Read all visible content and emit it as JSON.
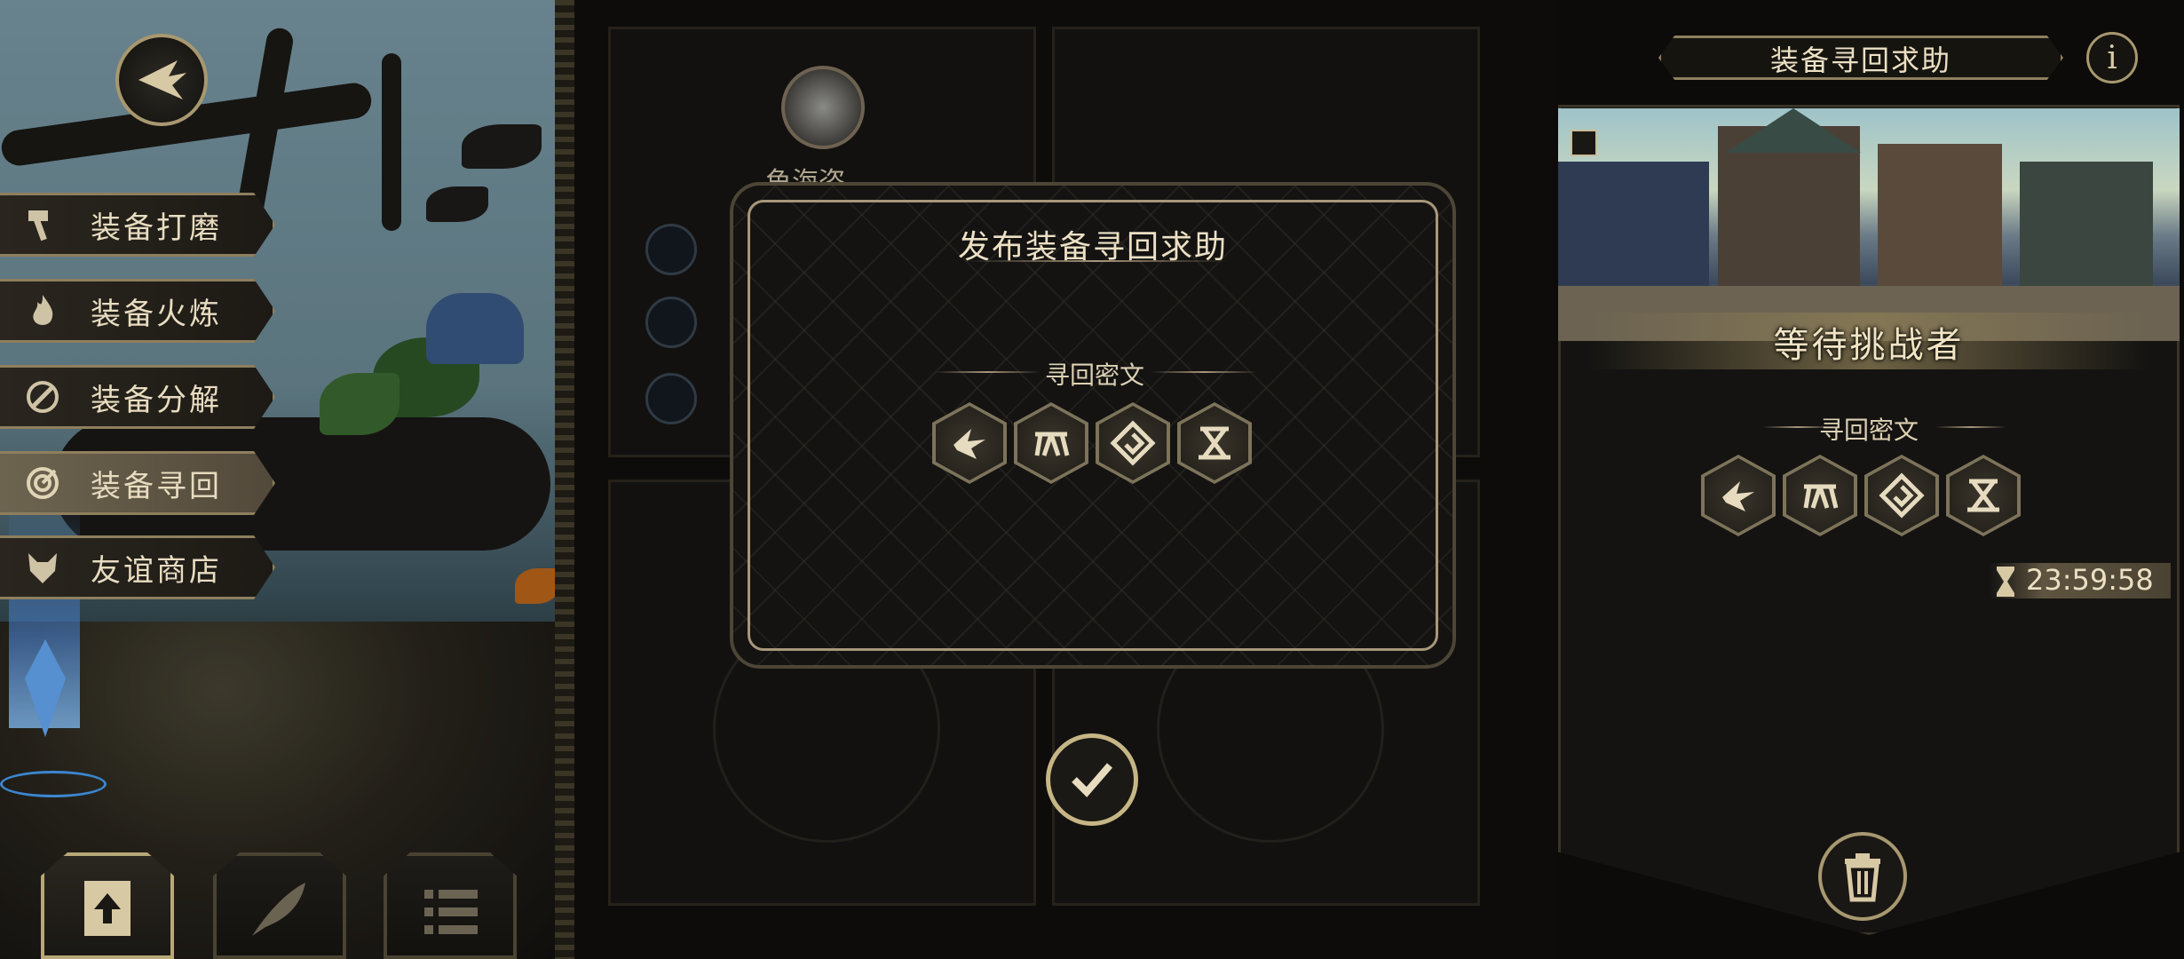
{
  "sidebar": {
    "items": [
      {
        "label": "装备打磨",
        "icon": "hammer-icon"
      },
      {
        "label": "装备火炼",
        "icon": "flame-icon"
      },
      {
        "label": "装备分解",
        "icon": "decompose-icon"
      },
      {
        "label": "装备寻回",
        "icon": "retrieve-icon",
        "active": true
      },
      {
        "label": "友谊商店",
        "icon": "fox-icon"
      }
    ]
  },
  "behind": {
    "monster_name": "鱼海盗"
  },
  "dialog": {
    "title": "发布装备寻回求助",
    "cipher_label": "寻回密文",
    "runes": [
      "rune-1-icon",
      "rune-2-icon",
      "rune-3-icon",
      "rune-4-icon"
    ]
  },
  "right_panel": {
    "title": "装备寻回求助",
    "info_label": "i",
    "status": "等待挑战者",
    "cipher_label": "寻回密文",
    "timer": "23:59:58"
  },
  "colors": {
    "gold": "#c6b685",
    "panel": "#141311",
    "text": "#e8dcc0"
  }
}
